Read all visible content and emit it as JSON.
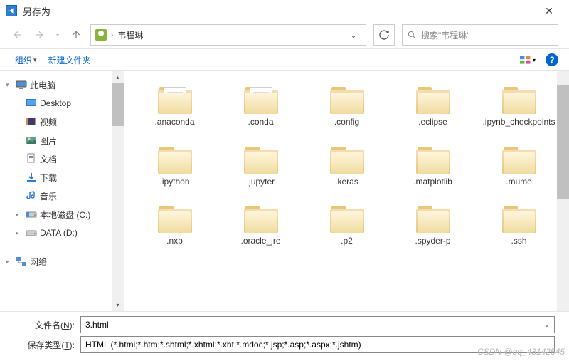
{
  "window": {
    "title": "另存为"
  },
  "breadcrumb": {
    "current": "韦程琳"
  },
  "search": {
    "placeholder": "搜索\"韦程琳\""
  },
  "toolbar": {
    "organize": "组织",
    "newfolder": "新建文件夹",
    "help": "?"
  },
  "tree": {
    "items": [
      {
        "icon": "pc",
        "label": "此电脑",
        "level": 0,
        "chev": "▾"
      },
      {
        "icon": "desktop",
        "label": "Desktop",
        "level": 1
      },
      {
        "icon": "video",
        "label": "视频",
        "level": 1
      },
      {
        "icon": "pictures",
        "label": "图片",
        "level": 1
      },
      {
        "icon": "docs",
        "label": "文档",
        "level": 1
      },
      {
        "icon": "downloads",
        "label": "下载",
        "level": 1
      },
      {
        "icon": "music",
        "label": "音乐",
        "level": 1
      },
      {
        "icon": "disk",
        "label": "本地磁盘 (C:)",
        "level": 1,
        "chev": "▸"
      },
      {
        "icon": "disk-d",
        "label": "DATA (D:)",
        "level": 1,
        "chev": "▸"
      },
      {
        "icon": "network",
        "label": "网络",
        "level": 0,
        "chev": "▸"
      }
    ]
  },
  "files": [
    {
      "name": ".anaconda",
      "paper": true
    },
    {
      "name": ".conda",
      "paper": true
    },
    {
      "name": ".config"
    },
    {
      "name": ".eclipse"
    },
    {
      "name": ".ipynb_checkpoints"
    },
    {
      "name": ".ipython"
    },
    {
      "name": ".jupyter"
    },
    {
      "name": ".keras"
    },
    {
      "name": ".matplotlib"
    },
    {
      "name": ".mume"
    },
    {
      "name": ".nxp"
    },
    {
      "name": ".oracle_jre"
    },
    {
      "name": ".p2"
    },
    {
      "name": ".spyder-p"
    },
    {
      "name": ".ssh"
    }
  ],
  "form": {
    "filename_label_pre": "文件名(",
    "filename_label_u": "N",
    "filename_label_post": "):",
    "filetype_label_pre": "保存类型(",
    "filetype_label_u": "T",
    "filetype_label_post": "):",
    "filename_value": "3.html",
    "filetype_value": "HTML (*.html;*.htm;*.shtml;*.xhtml;*.xht;*.mdoc;*.jsp;*.asp;*.aspx;*.jshtm)"
  },
  "watermark": "CSDN @qq_43142545"
}
